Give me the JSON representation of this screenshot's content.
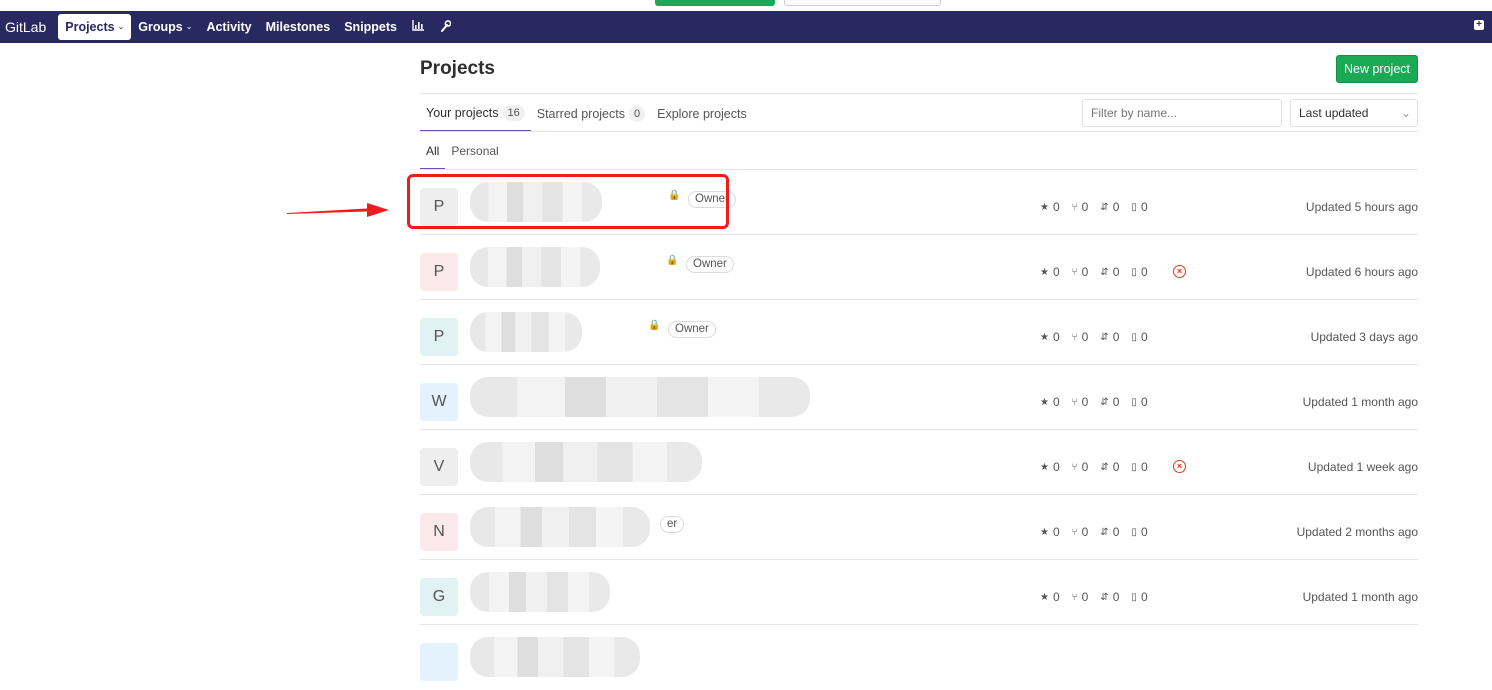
{
  "navbar": {
    "brand": "GitLab",
    "items": [
      {
        "label": "Projects",
        "caret": "⌄"
      },
      {
        "label": "Groups",
        "caret": "⌄"
      },
      {
        "label": "Activity"
      },
      {
        "label": "Milestones"
      },
      {
        "label": "Snippets"
      }
    ],
    "icons": [
      "chart-icon",
      "wrench-icon"
    ],
    "plus": "+"
  },
  "header": {
    "title": "Projects",
    "new_button": "New project"
  },
  "tabs": [
    {
      "label": "Your projects",
      "count": "16"
    },
    {
      "label": "Starred projects",
      "count": "0"
    },
    {
      "label": "Explore projects"
    }
  ],
  "filter": {
    "placeholder": "Filter by name..."
  },
  "sort": {
    "selected": "Last updated",
    "chevron": "⌄"
  },
  "subtabs": [
    {
      "label": "All"
    },
    {
      "label": "Personal"
    }
  ],
  "projects": [
    {
      "initial": "P",
      "role": "Owner",
      "stars": "0",
      "forks": "0",
      "mrs": "0",
      "issues": "0",
      "pipeline_failed": false,
      "updated": "Updated 5 hours ago",
      "avatar_bg": "#eeeeee"
    },
    {
      "initial": "P",
      "role": "Owner",
      "stars": "0",
      "forks": "0",
      "mrs": "0",
      "issues": "0",
      "pipeline_failed": true,
      "updated": "Updated 6 hours ago",
      "avatar_bg": "#fbe9eb"
    },
    {
      "initial": "P",
      "role": "Owner",
      "stars": "0",
      "forks": "0",
      "mrs": "0",
      "issues": "0",
      "pipeline_failed": false,
      "updated": "Updated 3 days ago",
      "avatar_bg": "#e0f2f1"
    },
    {
      "initial": "W",
      "role": "",
      "stars": "0",
      "forks": "0",
      "mrs": "0",
      "issues": "0",
      "pipeline_failed": false,
      "updated": "Updated 1 month ago",
      "avatar_bg": "#e3f2fd"
    },
    {
      "initial": "V",
      "role": "",
      "stars": "0",
      "forks": "0",
      "mrs": "0",
      "issues": "0",
      "pipeline_failed": true,
      "updated": "Updated 1 week ago",
      "avatar_bg": "#eeeeee"
    },
    {
      "initial": "N",
      "role": "er",
      "stars": "0",
      "forks": "0",
      "mrs": "0",
      "issues": "0",
      "pipeline_failed": false,
      "updated": "Updated 2 months ago",
      "avatar_bg": "#fbe9eb"
    },
    {
      "initial": "G",
      "role": "",
      "stars": "0",
      "forks": "0",
      "mrs": "0",
      "issues": "0",
      "pipeline_failed": false,
      "updated": "Updated 1 month ago",
      "avatar_bg": "#e0f2f1"
    }
  ],
  "colors": {
    "navbar": "#292961",
    "accent": "#6b4fbb",
    "success": "#1aaa55",
    "danger": "#db3b21",
    "annotation": "#ee1d1d"
  }
}
